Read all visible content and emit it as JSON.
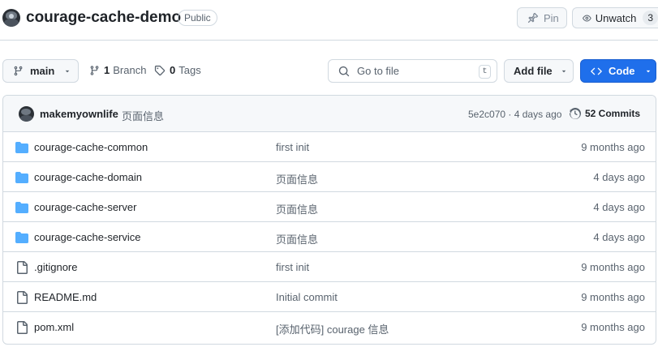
{
  "repo": {
    "name": "courage-cache-demo",
    "visibility": "Public",
    "pin_label": "Pin",
    "watch_label": "Unwatch",
    "watch_count": "3"
  },
  "toolbar": {
    "branch": "main",
    "branch_count": "1",
    "branch_label": "Branch",
    "tag_count": "0",
    "tag_label": "Tags",
    "search_placeholder": "Go to file",
    "search_shortcut": "t",
    "add_file_label": "Add file",
    "code_label": "Code"
  },
  "latest_commit": {
    "author": "makemyownlife",
    "message": "页面信息",
    "meta": "5e2c070 · 4 days ago",
    "commits_label": "52 Commits"
  },
  "files": [
    {
      "type": "folder",
      "name": "courage-cache-common",
      "commit": "first init",
      "time": "9 months ago"
    },
    {
      "type": "folder",
      "name": "courage-cache-domain",
      "commit": "页面信息",
      "time": "4 days ago"
    },
    {
      "type": "folder",
      "name": "courage-cache-server",
      "commit": "页面信息",
      "time": "4 days ago"
    },
    {
      "type": "folder",
      "name": "courage-cache-service",
      "commit": "页面信息",
      "time": "4 days ago"
    },
    {
      "type": "file",
      "name": ".gitignore",
      "commit": "first init",
      "time": "9 months ago"
    },
    {
      "type": "file",
      "name": "README.md",
      "commit": "Initial commit",
      "time": "9 months ago"
    },
    {
      "type": "file",
      "name": "pom.xml",
      "commit": "[添加代码] courage 信息",
      "time": "9 months ago"
    }
  ],
  "colors": {
    "accent": "#1f6feb",
    "folder": "#54aeff",
    "muted_text": "#59636e",
    "border": "#d1d9e0"
  }
}
